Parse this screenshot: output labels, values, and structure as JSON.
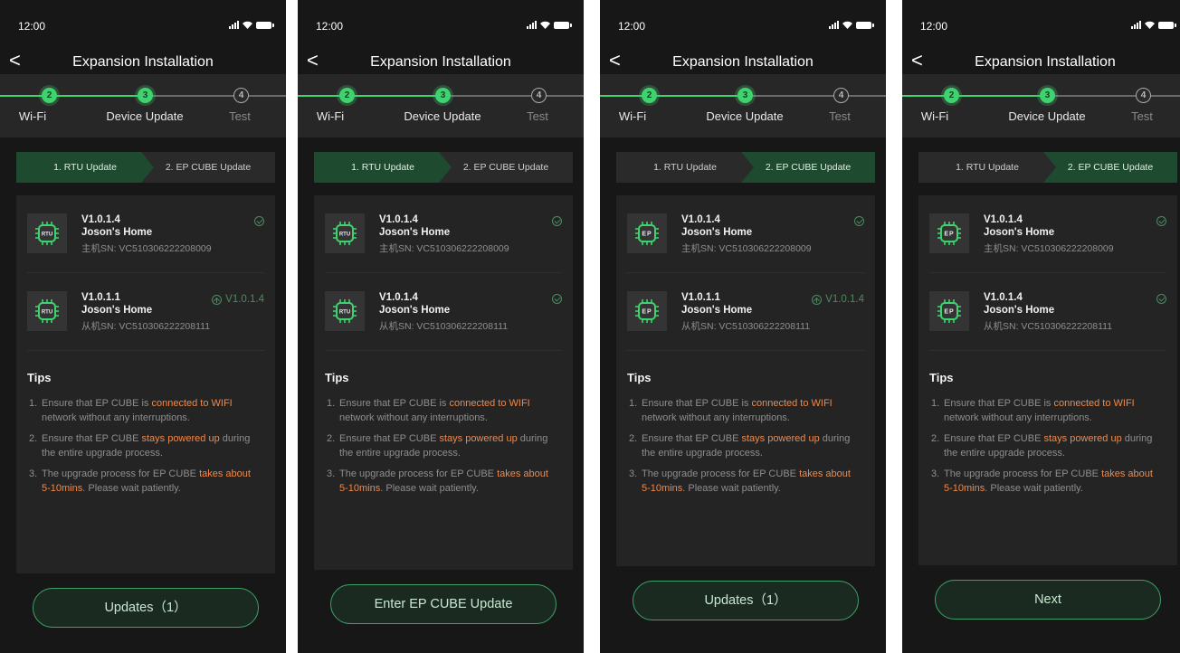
{
  "status_bar": {
    "time": "12:00"
  },
  "nav": {
    "title": "Expansion Installation",
    "back": "<"
  },
  "steps": [
    {
      "number": "2",
      "label": "Wi-Fi",
      "state": "active"
    },
    {
      "number": "3",
      "label": "Device Update",
      "state": "active"
    },
    {
      "number": "4",
      "label": "Test",
      "state": "inactive"
    }
  ],
  "tabs": {
    "rtu": "1. RTU Update",
    "cube": "2. EP CUBE Update"
  },
  "tips": {
    "title": "Tips",
    "items": [
      {
        "num": "1.",
        "pre": "Ensure that EP CUBE is ",
        "hl": "connected to WIFI",
        "post": " network without any interruptions."
      },
      {
        "num": "2.",
        "pre": "Ensure that EP CUBE ",
        "hl": "stays powered up",
        "post": " during the entire upgrade process."
      },
      {
        "num": "3.",
        "pre": "The upgrade process for EP CUBE ",
        "hl": "takes about 5-10mins",
        "post": ". Please wait patiently."
      }
    ]
  },
  "colors": {
    "accent": "#3ed36e",
    "highlight": "#f0894a",
    "background": "#171717",
    "panel": "#242424"
  },
  "screens": [
    {
      "active_tab": "rtu",
      "devices": [
        {
          "icon": "rtu-icon",
          "icon_text": "RTU",
          "version": "V1.0.1.4",
          "name": "Joson's Home",
          "sn": "主机SN: VC510306222208009",
          "status": "done",
          "target": ""
        },
        {
          "icon": "rtu-icon",
          "icon_text": "RTU",
          "version": "V1.0.1.1",
          "name": "Joson's Home",
          "sn": "从机SN: VC510306222208111",
          "status": "upgrade",
          "target": "V1.0.1.4"
        }
      ],
      "button": "Updates（1）"
    },
    {
      "active_tab": "rtu",
      "devices": [
        {
          "icon": "rtu-icon",
          "icon_text": "RTU",
          "version": "V1.0.1.4",
          "name": "Joson's Home",
          "sn": "主机SN: VC510306222208009",
          "status": "done",
          "target": ""
        },
        {
          "icon": "rtu-icon",
          "icon_text": "RTU",
          "version": "V1.0.1.4",
          "name": "Joson's Home",
          "sn": "从机SN: VC510306222208111",
          "status": "done",
          "target": ""
        }
      ],
      "button": "Enter EP CUBE Update"
    },
    {
      "active_tab": "cube",
      "devices": [
        {
          "icon": "ep-cube-icon",
          "icon_text": "EP",
          "version": "V1.0.1.4",
          "name": "Joson's Home",
          "sn": "主机SN: VC510306222208009",
          "status": "done",
          "target": ""
        },
        {
          "icon": "ep-cube-icon",
          "icon_text": "EP",
          "version": "V1.0.1.1",
          "name": "Joson's Home",
          "sn": "从机SN: VC510306222208111",
          "status": "upgrade",
          "target": "V1.0.1.4"
        }
      ],
      "button": "Updates（1）"
    },
    {
      "active_tab": "cube",
      "devices": [
        {
          "icon": "ep-cube-icon",
          "icon_text": "EP",
          "version": "V1.0.1.4",
          "name": "Joson's Home",
          "sn": "主机SN: VC510306222208009",
          "status": "done",
          "target": ""
        },
        {
          "icon": "ep-cube-icon",
          "icon_text": "EP",
          "version": "V1.0.1.4",
          "name": "Joson's Home",
          "sn": "从机SN: VC510306222208111",
          "status": "done",
          "target": ""
        }
      ],
      "button": "Next"
    }
  ]
}
